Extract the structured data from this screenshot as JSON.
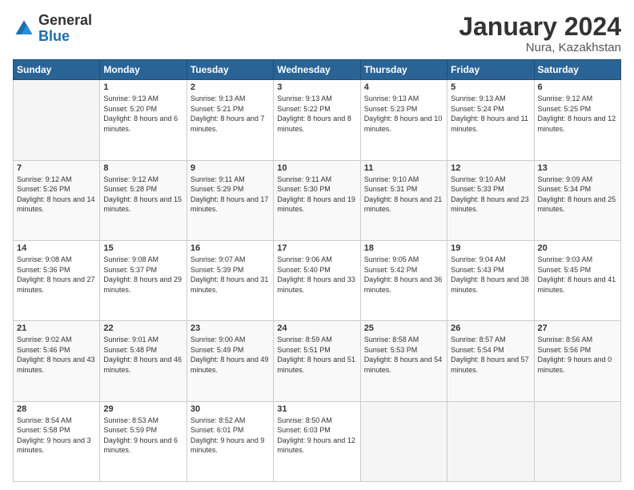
{
  "logo": {
    "general": "General",
    "blue": "Blue"
  },
  "title": "January 2024",
  "subtitle": "Nura, Kazakhstan",
  "headers": [
    "Sunday",
    "Monday",
    "Tuesday",
    "Wednesday",
    "Thursday",
    "Friday",
    "Saturday"
  ],
  "weeks": [
    [
      {
        "day": "",
        "sunrise": "",
        "sunset": "",
        "daylight": "",
        "empty": true
      },
      {
        "day": "1",
        "sunrise": "Sunrise: 9:13 AM",
        "sunset": "Sunset: 5:20 PM",
        "daylight": "Daylight: 8 hours and 6 minutes.",
        "empty": false
      },
      {
        "day": "2",
        "sunrise": "Sunrise: 9:13 AM",
        "sunset": "Sunset: 5:21 PM",
        "daylight": "Daylight: 8 hours and 7 minutes.",
        "empty": false
      },
      {
        "day": "3",
        "sunrise": "Sunrise: 9:13 AM",
        "sunset": "Sunset: 5:22 PM",
        "daylight": "Daylight: 8 hours and 8 minutes.",
        "empty": false
      },
      {
        "day": "4",
        "sunrise": "Sunrise: 9:13 AM",
        "sunset": "Sunset: 5:23 PM",
        "daylight": "Daylight: 8 hours and 10 minutes.",
        "empty": false
      },
      {
        "day": "5",
        "sunrise": "Sunrise: 9:13 AM",
        "sunset": "Sunset: 5:24 PM",
        "daylight": "Daylight: 8 hours and 11 minutes.",
        "empty": false
      },
      {
        "day": "6",
        "sunrise": "Sunrise: 9:12 AM",
        "sunset": "Sunset: 5:25 PM",
        "daylight": "Daylight: 8 hours and 12 minutes.",
        "empty": false
      }
    ],
    [
      {
        "day": "7",
        "sunrise": "Sunrise: 9:12 AM",
        "sunset": "Sunset: 5:26 PM",
        "daylight": "Daylight: 8 hours and 14 minutes.",
        "empty": false
      },
      {
        "day": "8",
        "sunrise": "Sunrise: 9:12 AM",
        "sunset": "Sunset: 5:28 PM",
        "daylight": "Daylight: 8 hours and 15 minutes.",
        "empty": false
      },
      {
        "day": "9",
        "sunrise": "Sunrise: 9:11 AM",
        "sunset": "Sunset: 5:29 PM",
        "daylight": "Daylight: 8 hours and 17 minutes.",
        "empty": false
      },
      {
        "day": "10",
        "sunrise": "Sunrise: 9:11 AM",
        "sunset": "Sunset: 5:30 PM",
        "daylight": "Daylight: 8 hours and 19 minutes.",
        "empty": false
      },
      {
        "day": "11",
        "sunrise": "Sunrise: 9:10 AM",
        "sunset": "Sunset: 5:31 PM",
        "daylight": "Daylight: 8 hours and 21 minutes.",
        "empty": false
      },
      {
        "day": "12",
        "sunrise": "Sunrise: 9:10 AM",
        "sunset": "Sunset: 5:33 PM",
        "daylight": "Daylight: 8 hours and 23 minutes.",
        "empty": false
      },
      {
        "day": "13",
        "sunrise": "Sunrise: 9:09 AM",
        "sunset": "Sunset: 5:34 PM",
        "daylight": "Daylight: 8 hours and 25 minutes.",
        "empty": false
      }
    ],
    [
      {
        "day": "14",
        "sunrise": "Sunrise: 9:08 AM",
        "sunset": "Sunset: 5:36 PM",
        "daylight": "Daylight: 8 hours and 27 minutes.",
        "empty": false
      },
      {
        "day": "15",
        "sunrise": "Sunrise: 9:08 AM",
        "sunset": "Sunset: 5:37 PM",
        "daylight": "Daylight: 8 hours and 29 minutes.",
        "empty": false
      },
      {
        "day": "16",
        "sunrise": "Sunrise: 9:07 AM",
        "sunset": "Sunset: 5:39 PM",
        "daylight": "Daylight: 8 hours and 31 minutes.",
        "empty": false
      },
      {
        "day": "17",
        "sunrise": "Sunrise: 9:06 AM",
        "sunset": "Sunset: 5:40 PM",
        "daylight": "Daylight: 8 hours and 33 minutes.",
        "empty": false
      },
      {
        "day": "18",
        "sunrise": "Sunrise: 9:05 AM",
        "sunset": "Sunset: 5:42 PM",
        "daylight": "Daylight: 8 hours and 36 minutes.",
        "empty": false
      },
      {
        "day": "19",
        "sunrise": "Sunrise: 9:04 AM",
        "sunset": "Sunset: 5:43 PM",
        "daylight": "Daylight: 8 hours and 38 minutes.",
        "empty": false
      },
      {
        "day": "20",
        "sunrise": "Sunrise: 9:03 AM",
        "sunset": "Sunset: 5:45 PM",
        "daylight": "Daylight: 8 hours and 41 minutes.",
        "empty": false
      }
    ],
    [
      {
        "day": "21",
        "sunrise": "Sunrise: 9:02 AM",
        "sunset": "Sunset: 5:46 PM",
        "daylight": "Daylight: 8 hours and 43 minutes.",
        "empty": false
      },
      {
        "day": "22",
        "sunrise": "Sunrise: 9:01 AM",
        "sunset": "Sunset: 5:48 PM",
        "daylight": "Daylight: 8 hours and 46 minutes.",
        "empty": false
      },
      {
        "day": "23",
        "sunrise": "Sunrise: 9:00 AM",
        "sunset": "Sunset: 5:49 PM",
        "daylight": "Daylight: 8 hours and 49 minutes.",
        "empty": false
      },
      {
        "day": "24",
        "sunrise": "Sunrise: 8:59 AM",
        "sunset": "Sunset: 5:51 PM",
        "daylight": "Daylight: 8 hours and 51 minutes.",
        "empty": false
      },
      {
        "day": "25",
        "sunrise": "Sunrise: 8:58 AM",
        "sunset": "Sunset: 5:53 PM",
        "daylight": "Daylight: 8 hours and 54 minutes.",
        "empty": false
      },
      {
        "day": "26",
        "sunrise": "Sunrise: 8:57 AM",
        "sunset": "Sunset: 5:54 PM",
        "daylight": "Daylight: 8 hours and 57 minutes.",
        "empty": false
      },
      {
        "day": "27",
        "sunrise": "Sunrise: 8:56 AM",
        "sunset": "Sunset: 5:56 PM",
        "daylight": "Daylight: 9 hours and 0 minutes.",
        "empty": false
      }
    ],
    [
      {
        "day": "28",
        "sunrise": "Sunrise: 8:54 AM",
        "sunset": "Sunset: 5:58 PM",
        "daylight": "Daylight: 9 hours and 3 minutes.",
        "empty": false
      },
      {
        "day": "29",
        "sunrise": "Sunrise: 8:53 AM",
        "sunset": "Sunset: 5:59 PM",
        "daylight": "Daylight: 9 hours and 6 minutes.",
        "empty": false
      },
      {
        "day": "30",
        "sunrise": "Sunrise: 8:52 AM",
        "sunset": "Sunset: 6:01 PM",
        "daylight": "Daylight: 9 hours and 9 minutes.",
        "empty": false
      },
      {
        "day": "31",
        "sunrise": "Sunrise: 8:50 AM",
        "sunset": "Sunset: 6:03 PM",
        "daylight": "Daylight: 9 hours and 12 minutes.",
        "empty": false
      },
      {
        "day": "",
        "sunrise": "",
        "sunset": "",
        "daylight": "",
        "empty": true
      },
      {
        "day": "",
        "sunrise": "",
        "sunset": "",
        "daylight": "",
        "empty": true
      },
      {
        "day": "",
        "sunrise": "",
        "sunset": "",
        "daylight": "",
        "empty": true
      }
    ]
  ]
}
